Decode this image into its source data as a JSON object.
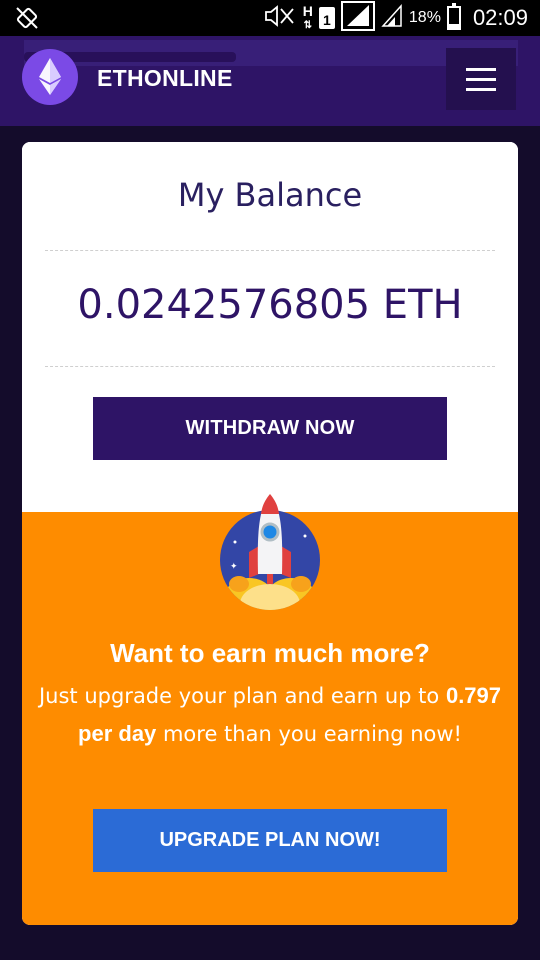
{
  "status_bar": {
    "network_letter": "H",
    "sim_slot": "1",
    "battery": "18%",
    "time": "02:09"
  },
  "header": {
    "brand": "ETHONLINE",
    "logo_icon": "ethereum-logo-icon",
    "menu_icon": "hamburger-menu-icon"
  },
  "balance_card": {
    "title": "My Balance",
    "amount": "0.0242576805 ETH",
    "withdraw_label": "WITHDRAW NOW"
  },
  "upgrade_section": {
    "icon": "rocket-icon",
    "heading": "Want to earn much more?",
    "text_before": "Just upgrade your plan and earn up to ",
    "highlight": "0.797 per day",
    "text_after": " more than you earning now!",
    "upgrade_label": "UPGRADE PLAN NOW!"
  },
  "colors": {
    "brand_purple": "#2e1466",
    "orange": "#fe8c00",
    "blue_button": "#2b6bd6",
    "logo_purple": "#7b4ae6"
  }
}
